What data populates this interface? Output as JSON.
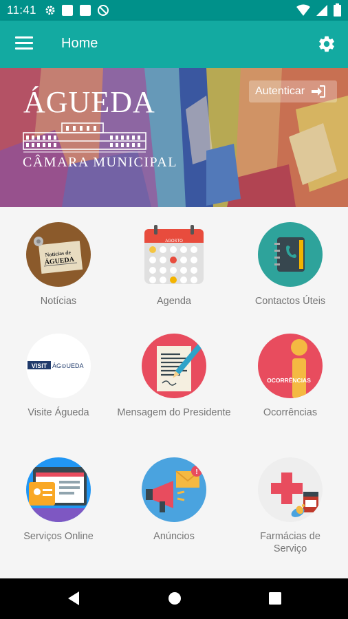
{
  "status_bar": {
    "time": "11:41"
  },
  "app_bar": {
    "title": "Home"
  },
  "banner": {
    "title": "ÁGUEDA",
    "subtitle": "CÂMARA MUNICIPAL",
    "auth_label": "Autenticar"
  },
  "grid": {
    "items": [
      {
        "label": "Notícias",
        "icon": "newspaper-icon"
      },
      {
        "label": "Agenda",
        "icon": "calendar-icon",
        "calendar_month": "AGOSTO"
      },
      {
        "label": "Contactos Úteis",
        "icon": "address-book-icon"
      },
      {
        "label": "Visite Águeda",
        "icon": "visit-agueda-logo",
        "logo_a": "VISIT",
        "logo_b": "ÁG⊙UEDA"
      },
      {
        "label": "Mensagem do Presidente",
        "icon": "document-pen-icon"
      },
      {
        "label": "Ocorrências",
        "icon": "occurrences-icon",
        "badge": "OCORRÊNCIAS"
      },
      {
        "label": "Serviços Online",
        "icon": "online-services-icon"
      },
      {
        "label": "Anúncios",
        "icon": "megaphone-icon"
      },
      {
        "label": "Farmácias de Serviço",
        "icon": "pharmacy-icon"
      }
    ]
  },
  "colors": {
    "primary": "#13aaa1",
    "primary_dark": "#00918a",
    "label": "#757575"
  }
}
